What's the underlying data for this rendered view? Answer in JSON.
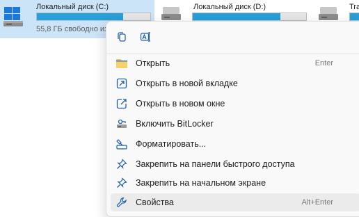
{
  "drives": [
    {
      "name": "Локальный диск (C:)",
      "free_text": "55,8 ГБ свободно из",
      "used_fraction": 0.76,
      "selected": true
    },
    {
      "name": "Локальный диск (D:)",
      "free_text": "",
      "used_fraction": 0.77,
      "selected": false
    },
    {
      "name": "Tra",
      "free_text": "",
      "used_fraction": 0.9,
      "selected": false
    }
  ],
  "menu": {
    "quick_actions": [
      {
        "icon": "copy-icon"
      },
      {
        "icon": "rename-icon"
      }
    ],
    "items": [
      {
        "label": "Открыть",
        "shortcut": "Enter",
        "icon": "folder-icon"
      },
      {
        "label": "Открыть в новой вкладке",
        "shortcut": "",
        "icon": "open-new-tab-icon"
      },
      {
        "label": "Открыть в новом окне",
        "shortcut": "",
        "icon": "open-new-window-icon"
      },
      {
        "label": "Включить BitLocker",
        "shortcut": "",
        "icon": "bitlocker-key-icon"
      },
      {
        "label": "Форматировать...",
        "shortcut": "",
        "icon": "format-drive-icon"
      },
      {
        "label": "Закрепить на панели быстрого доступа",
        "shortcut": "",
        "icon": "pin-icon"
      },
      {
        "label": "Закрепить на начальном экране",
        "shortcut": "",
        "icon": "pin-icon"
      },
      {
        "label": "Свойства",
        "shortcut": "Alt+Enter",
        "icon": "wrench-icon"
      }
    ]
  },
  "colors": {
    "accent": "#26a0da",
    "selection": "#cce4f7",
    "icon_blue": "#1f5fa8",
    "folder_yellow": "#f2c14e"
  }
}
